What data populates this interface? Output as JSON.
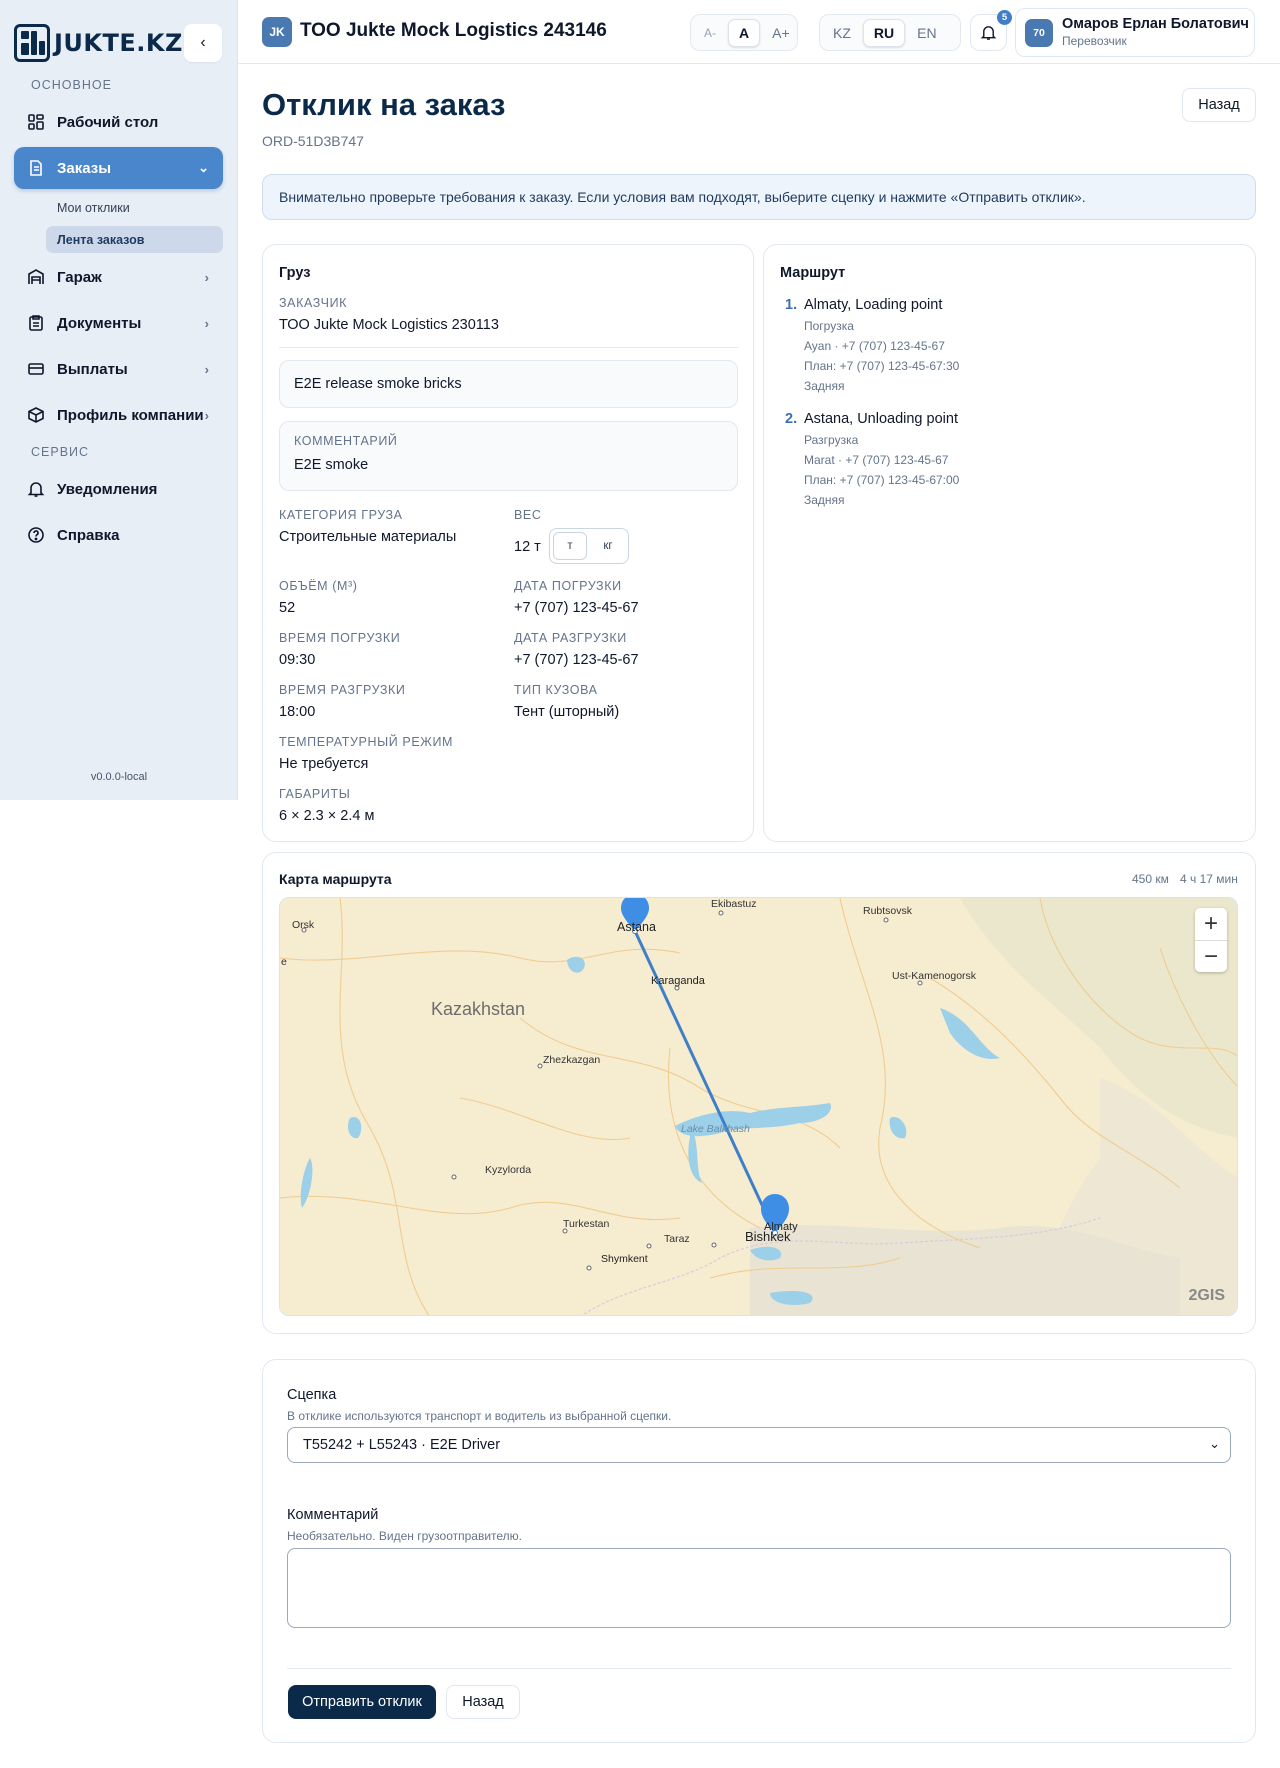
{
  "brand": {
    "name": "JUKTE.KZ"
  },
  "sidebar": {
    "section_main": "ОСНОВНОЕ",
    "section_service": "СЕРВИС",
    "items": [
      {
        "label": "Рабочий стол"
      },
      {
        "label": "Заказы"
      },
      {
        "label": "Гараж"
      },
      {
        "label": "Документы"
      },
      {
        "label": "Выплаты"
      },
      {
        "label": "Профиль компании"
      },
      {
        "label": "Уведомления"
      },
      {
        "label": "Справка"
      }
    ],
    "subitems": [
      {
        "label": "Мои отклики"
      },
      {
        "label": "Лента заказов"
      }
    ],
    "version": "v0.0.0-local"
  },
  "topbar": {
    "company_badge": "JK",
    "company_name": "ТОО Jukte Mock Logistics 243146",
    "font_sizes": [
      "A-",
      "A",
      "A+"
    ],
    "languages": [
      "KZ",
      "RU",
      "EN"
    ],
    "notifications_count": "5",
    "user_initials": "70",
    "user_name": "Омаров Ерлан Болатович",
    "user_role": "Перевозчик"
  },
  "page": {
    "title": "Отклик на заказ",
    "order_id": "ORD-51D3B747",
    "back_label": "Назад",
    "alert": "Внимательно проверьте требования к заказу. Если условия вам подходят, выберите сцепку и нажмите «Отправить отклик»."
  },
  "cargo": {
    "title": "Груз",
    "customer_label": "ЗАКАЗЧИК",
    "customer": "ТОО Jukte Mock Logistics 230113",
    "description": "E2E release smoke bricks",
    "comment_label": "КОММЕНТАРИЙ",
    "comment": "E2E smoke",
    "category_label": "КАТЕГОРИЯ ГРУЗА",
    "category": "Строительные материалы",
    "weight_label": "ВЕС",
    "weight": "12 т",
    "weight_units": [
      "т",
      "кг"
    ],
    "volume_label": "ОБЪЁМ (М³)",
    "volume": "52",
    "load_date_label": "ДАТА ПОГРУЗКИ",
    "load_date": "+7 (707) 123-45-67",
    "load_time_label": "ВРЕМЯ ПОГРУЗКИ",
    "load_time": "09:30",
    "unload_date_label": "ДАТА РАЗГРУЗКИ",
    "unload_date": "+7 (707) 123-45-67",
    "unload_time_label": "ВРЕМЯ РАЗГРУЗКИ",
    "unload_time": "18:00",
    "body_type_label": "ТИП КУЗОВА",
    "body_type": "Тент (шторный)",
    "temp_label": "ТЕМПЕРАТУРНЫЙ РЕЖИМ",
    "temp": "Не требуется",
    "dims_label": "ГАБАРИТЫ",
    "dims": "6 × 2.3 × 2.4 м"
  },
  "route": {
    "title": "Маршрут",
    "points": [
      {
        "num": "1.",
        "name": "Almaty, Loading point",
        "type": "Погрузка",
        "contact": "Ayan · +7 (707) 123-45-67",
        "plan": "План: +7 (707) 123-45-67:30",
        "loading": "Задняя"
      },
      {
        "num": "2.",
        "name": "Astana, Unloading point",
        "type": "Разгрузка",
        "contact": "Marat · +7 (707) 123-45-67",
        "plan": "План: +7 (707) 123-45-67:00",
        "loading": "Задняя"
      }
    ]
  },
  "map": {
    "title": "Карта маршрута",
    "distance": "450 км",
    "duration": "4 ч 17 мин",
    "attribution": "2GIS",
    "labels": [
      "Orsk",
      "Astana",
      "Ekibastuz",
      "Rubtsovsk",
      "Karaganda",
      "Ust-Kamenogorsk",
      "Kazakhstan",
      "Zhezkazgan",
      "Lake Balkhash",
      "Kyzylorda",
      "Turkestan",
      "Taraz",
      "Bishkek",
      "Almaty",
      "Shymkent",
      "e"
    ]
  },
  "form": {
    "hitch_label": "Сцепка",
    "hitch_hint": "В отклике используются транспорт и водитель из выбранной сцепки.",
    "hitch_value": "T55242 + L55243 · E2E Driver",
    "comment_label": "Комментарий",
    "comment_hint": "Необязательно. Виден грузоотправителю.",
    "submit_label": "Отправить отклик",
    "back_label": "Назад"
  }
}
